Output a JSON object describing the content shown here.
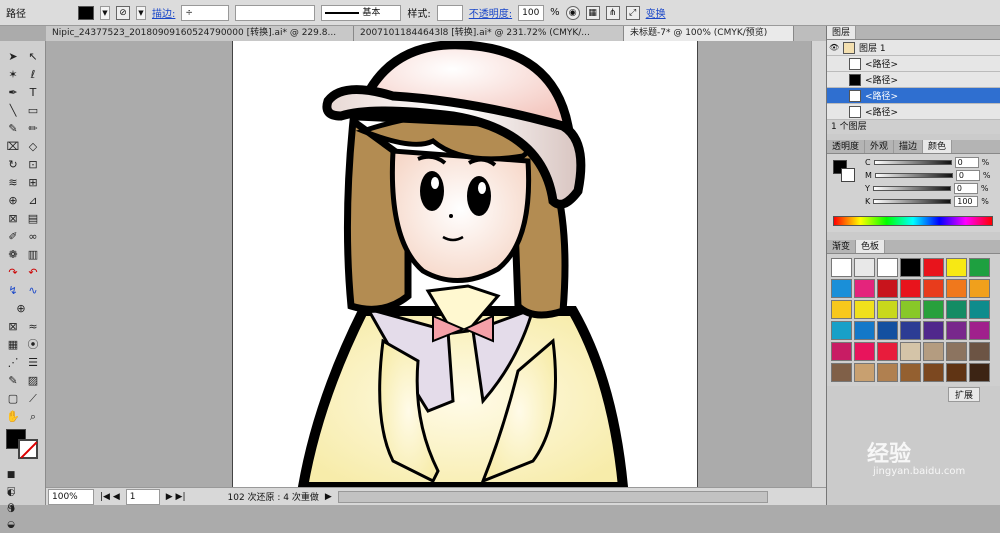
{
  "control_bar": {
    "object_type": "路径",
    "stroke_link": "描边:",
    "stroke_style_label": "基本",
    "style_label": "样式:",
    "opacity_link": "不透明度:",
    "opacity_value": "100",
    "opacity_unit": "%",
    "transform_link": "变换"
  },
  "tabs": [
    {
      "label": "Nipic_24377523_20180909160524790000 [转换].ai* @ 229.8..."
    },
    {
      "label": "20071011844643l8 [转换].ai* @ 231.72% (CMYK/..."
    },
    {
      "label": "未标题-7* @ 100% (CMYK/预览)"
    }
  ],
  "status_bar": {
    "zoom": "100%",
    "page": "1",
    "history": "102 次还原 : 4 次重做"
  },
  "layers_panel": {
    "title": "图层",
    "layer_name": "图层 1",
    "items": [
      "<路径>",
      "<路径>",
      "<路径>",
      "<路径>"
    ],
    "selected_index": 2,
    "count": "1 个图层"
  },
  "color_panel": {
    "tabs": [
      "透明度",
      "外观",
      "描边",
      "颜色"
    ],
    "active_tab": "颜色",
    "channels": [
      {
        "label": "C",
        "value": "0"
      },
      {
        "label": "M",
        "value": "0"
      },
      {
        "label": "Y",
        "value": "0"
      },
      {
        "label": "K",
        "value": "100"
      }
    ]
  },
  "swatches_panel": {
    "tabs": [
      "渐变",
      "色板"
    ],
    "active_tab": "色板",
    "colors": [
      "#ffffff",
      "#e8e8e8",
      "#ffffff",
      "#000000",
      "#e8141c",
      "#f7e814",
      "#1ea040",
      "#1a8fd8",
      "#e4247c",
      "#c8141c",
      "#e8141c",
      "#e83c1c",
      "#f0781c",
      "#f0a01c",
      "#f8c81c",
      "#f0e01c",
      "#c8d81c",
      "#88c828",
      "#28a03c",
      "#148c64",
      "#0e8c8c",
      "#18a0c8",
      "#1478c8",
      "#1450a0",
      "#2c3c94",
      "#50288c",
      "#78288c",
      "#a0208c",
      "#c81c64",
      "#e8145c",
      "#e81c3c",
      "#d4c4a8",
      "#b49c80",
      "#8c7460",
      "#6c5444",
      "#806048",
      "#c8a070",
      "#b08050",
      "#946030",
      "#7c4820",
      "#603414",
      "#3c2414"
    ],
    "extra_label": "扩展"
  },
  "watermark": {
    "text": "经验",
    "url": "jingyan.baidu.com"
  }
}
